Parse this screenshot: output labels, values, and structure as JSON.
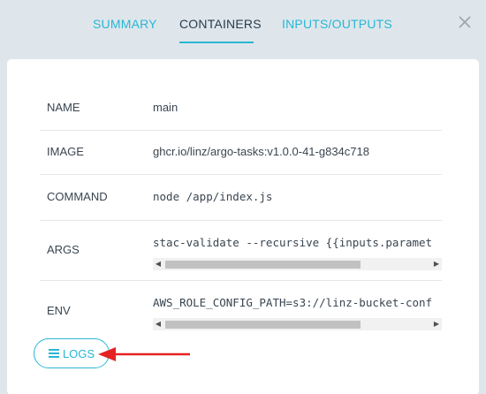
{
  "tabs": {
    "summary": "SUMMARY",
    "containers": "CONTAINERS",
    "inputs_outputs": "INPUTS/OUTPUTS",
    "active": "CONTAINERS"
  },
  "close_icon": "close-icon",
  "container": {
    "name_label": "NAME",
    "name_value": "main",
    "image_label": "IMAGE",
    "image_value": "ghcr.io/linz/argo-tasks:v1.0.0-41-g834c718",
    "command_label": "COMMAND",
    "command_value": "node /app/index.js",
    "args_label": "ARGS",
    "args_value": "stac-validate --recursive {{inputs.paramet",
    "args_scroll_fraction": 0.0,
    "env_label": "ENV",
    "env_value": "AWS_ROLE_CONFIG_PATH=s3://linz-bucket-conf",
    "env_scroll_fraction": 0.0
  },
  "logs_button": {
    "label": "LOGS",
    "icon": "hamburger-icon"
  },
  "annotation": {
    "arrow_color": "#e52222",
    "points_to": "logs-button"
  },
  "colors": {
    "accent": "#29b6d4",
    "background": "#dee6eb",
    "card": "#ffffff",
    "text": "#3a4550"
  }
}
